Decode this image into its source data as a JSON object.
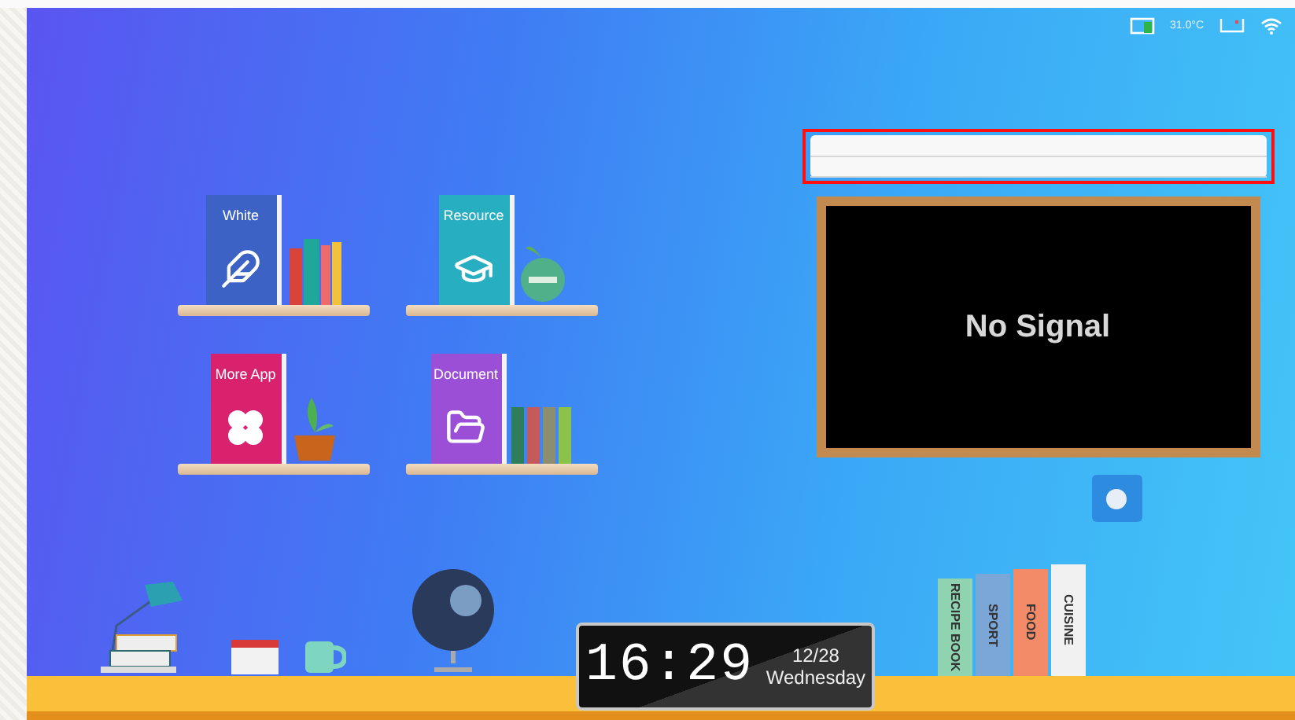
{
  "status_bar": {
    "temperature": "31.0°C"
  },
  "apps": [
    {
      "label": "White",
      "kind": "whiteboard",
      "color": "#3b62c4"
    },
    {
      "label": "Resource",
      "kind": "resource",
      "color": "#27aec0"
    },
    {
      "label": "More App",
      "kind": "more",
      "color": "#d8226e"
    },
    {
      "label": "Document",
      "kind": "document",
      "color": "#9a4fd6"
    }
  ],
  "input_panel": {
    "highlighted": true
  },
  "display": {
    "message": "No Signal"
  },
  "clock": {
    "time": "16:29",
    "date": "12/28",
    "weekday": "Wednesday"
  },
  "book_spines": [
    {
      "title": "RECIPE BOOK",
      "color": "#8fd3b0"
    },
    {
      "title": "SPORT",
      "color": "#7aa6d8"
    },
    {
      "title": "FOOD",
      "color": "#f38a68"
    },
    {
      "title": "CUISINE",
      "color": "#f1f1f1"
    }
  ]
}
